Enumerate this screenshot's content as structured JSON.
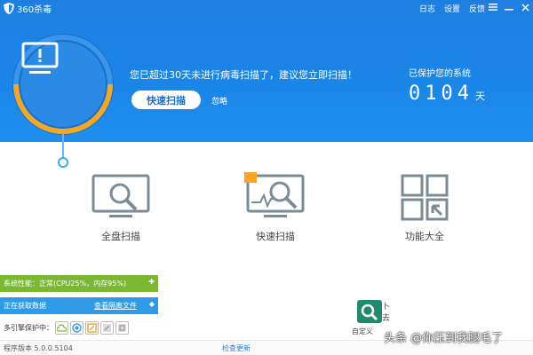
{
  "app": {
    "title": "360杀毒"
  },
  "titlebar": {
    "links": [
      "日志",
      "设置",
      "反馈"
    ]
  },
  "header": {
    "warning": "您已超过30天未进行病毒扫描了，建议您立即扫描！",
    "quick_scan_button": "快速扫描",
    "ignore_link": "忽略",
    "protected_label": "已保护您的系统",
    "protected_days": "0104",
    "days_unit": "天"
  },
  "features": {
    "full_scan": "全盘扫描",
    "quick_scan": "快速扫描",
    "toolbox": "功能大全"
  },
  "status": {
    "performance": "系统性能：正常(CPU25%，内存95%)",
    "fetching": "正在获取数据",
    "quarantine_link": "查看隔离文件",
    "engines_label": "多引擎保护中："
  },
  "footer": {
    "version": "程序版本 5.0.0.5104",
    "update_link": "检查更新"
  },
  "custom_tool": {
    "label": "自定义",
    "extra": "卜去"
  },
  "watermark": "头条 @你压到我腿毛了",
  "colors": {
    "header_blue": "#1a86e8",
    "ring_orange": "#f5a623",
    "status_green": "#7ab733",
    "status_blue": "#2f9be6"
  }
}
